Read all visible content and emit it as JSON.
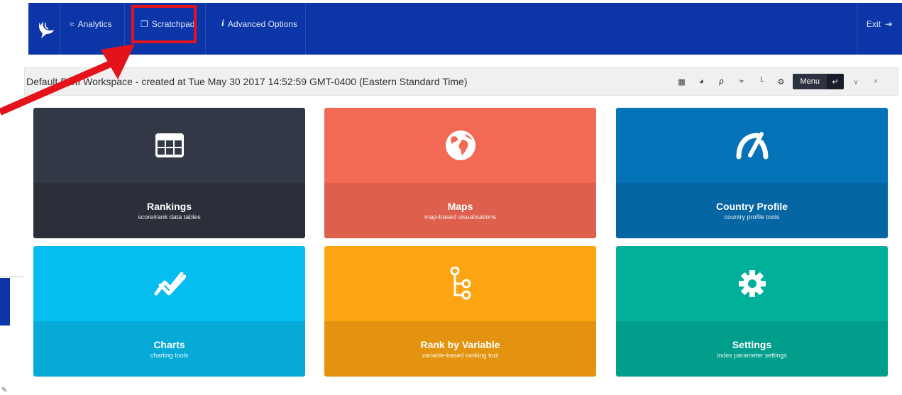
{
  "nav": {
    "items": [
      {
        "label": "Analytics",
        "icon": "chart-line-icon"
      },
      {
        "label": "Scratchpad",
        "icon": "clipboard-icon"
      },
      {
        "label": "Advanced Options",
        "icon": "info-icon"
      }
    ],
    "exit_label": "Exit",
    "background": "#0c35a8"
  },
  "annotation": {
    "color": "#e4121b"
  },
  "workspace": {
    "title": "Default RCII Workspace - created at Tue May 30 2017 14:52:59 GMT-0400 (Eastern Standard Time)",
    "menu_label": "Menu",
    "tools": [
      "table-icon",
      "globe-icon",
      "gauge-icon",
      "chart-icon",
      "tree-icon",
      "gear-icon"
    ]
  },
  "tiles": [
    {
      "title": "Rankings",
      "subtitle": "score/rank data tables",
      "icon": "table-icon",
      "top": "#323845",
      "bottom": "#2a2f3a"
    },
    {
      "title": "Maps",
      "subtitle": "map-based visualisations",
      "icon": "globe-icon",
      "top": "#f26a55",
      "bottom": "#dd5f4c"
    },
    {
      "title": "Country Profile",
      "subtitle": "country profile tools",
      "icon": "gauge-icon",
      "top": "#0372b6",
      "bottom": "#0566a3"
    },
    {
      "title": "Charts",
      "subtitle": "charting tools",
      "icon": "chart-icon",
      "top": "#05bdee",
      "bottom": "#06aad7"
    },
    {
      "title": "Rank by Variable",
      "subtitle": "variable-based ranking tool",
      "icon": "tree-icon",
      "top": "#fca412",
      "bottom": "#e3930f"
    },
    {
      "title": "Settings",
      "subtitle": "index parameter settings",
      "icon": "gear-icon",
      "top": "#01b09b",
      "bottom": "#019e8b"
    }
  ]
}
